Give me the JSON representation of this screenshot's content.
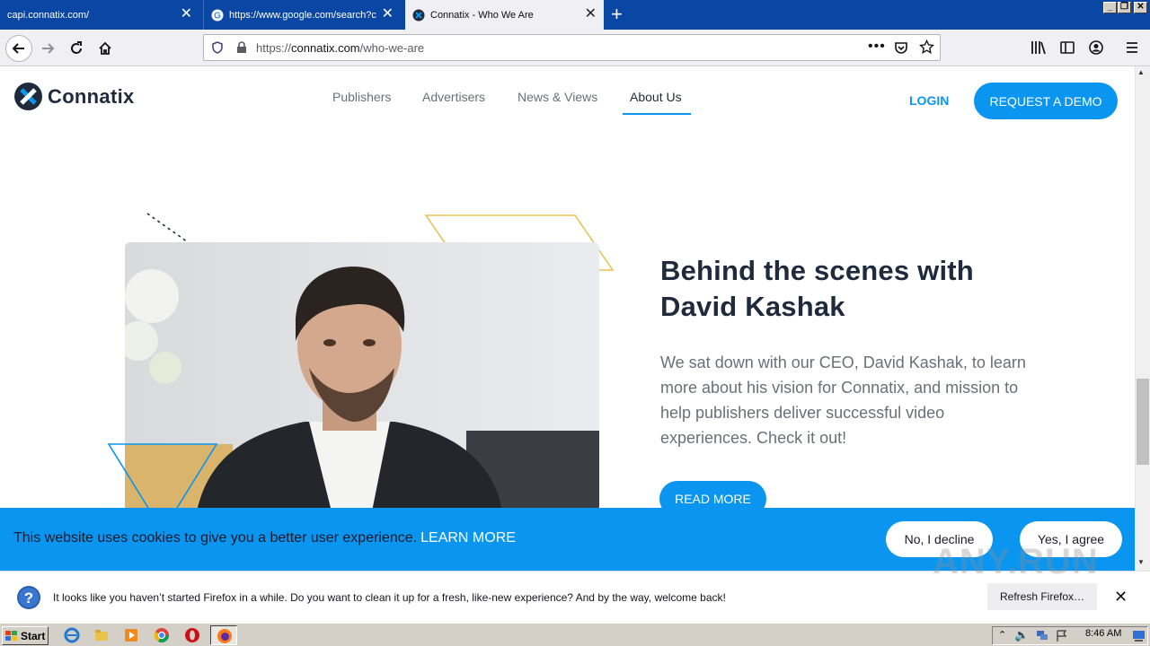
{
  "browser": {
    "tabs": [
      {
        "title": "capi.connatix.com/"
      },
      {
        "title": "https://www.google.com/search?c"
      },
      {
        "title": "Connatix - Who We Are"
      }
    ],
    "url_prefix": "https://",
    "url_domain": "connatix.com",
    "url_path": "/who-we-are"
  },
  "site": {
    "brand": "Connatix",
    "nav": [
      "Publishers",
      "Advertisers",
      "News & Views",
      "About Us"
    ],
    "login": "LOGIN",
    "demo": "REQUEST A DEMO",
    "heading": "Behind the scenes with David Kashak",
    "body": "We sat down with our CEO, David Kashak, to learn more about his vision for Connatix, and mission to help publishers deliver successful video experiences. Check it out!",
    "read_more": "READ MORE",
    "accent": "#0a96f0"
  },
  "cookie": {
    "text": "This website uses cookies to give you a better user experience.",
    "learn_more": "LEARN MORE",
    "decline": "No, I decline",
    "agree": "Yes, I agree"
  },
  "notification": {
    "text": "It looks like you haven’t started Firefox in a while. Do you want to clean it up for a fresh, like-new experience? And by the way, welcome back!",
    "button": "Refresh Firefox…"
  },
  "taskbar": {
    "start": "Start",
    "time": "8:46 AM"
  },
  "watermark": "ANY.RUN"
}
